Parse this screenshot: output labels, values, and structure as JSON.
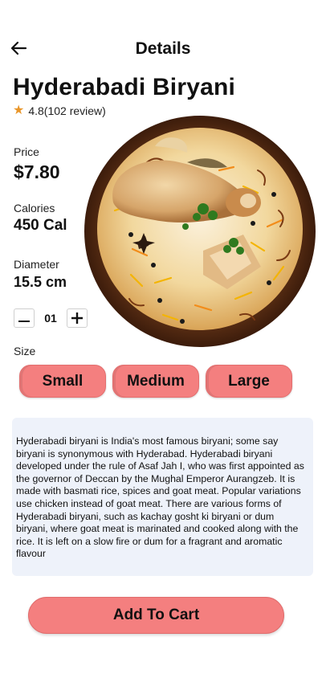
{
  "header": {
    "title": "Details",
    "back_icon": "arrow-left-icon"
  },
  "food": {
    "name": "Hyderabadi Biryani",
    "rating_icon": "star-icon",
    "rating_text": "4.8(102 review)",
    "image_icon": "biryani-bowl-image"
  },
  "stats": {
    "price_label": "Price",
    "price_value": "$7.80",
    "calories_label": "Calories",
    "calories_value": "450 Cal",
    "diameter_label": "Diameter",
    "diameter_value": "15.5 cm"
  },
  "quantity": {
    "value": "01",
    "minus_icon": "minus-icon",
    "plus_icon": "plus-icon"
  },
  "size": {
    "label": "Size",
    "options": [
      "Small",
      "Medium",
      "Large"
    ]
  },
  "description": "Hyderabadi biryani is India's most famous biryani; some say biryani is synonymous with Hyderabad. Hyderabadi biryani developed under the rule of Asaf Jah I, who was first appointed as the governor of Deccan by the Mughal Emperor Aurangzeb. It is made with basmati rice, spices and goat meat. Popular variations use chicken instead of goat meat. There are various forms of Hyderabadi biryani, such as kachay gosht ki biryani or dum biryani, where goat meat is marinated and cooked along with the rice. It is left on a slow fire or dum for a fragrant and aromatic flavour",
  "cart": {
    "label": "Add To Cart"
  },
  "colors": {
    "accent": "#f47f7f",
    "card_bg": "#eef2fa",
    "star": "#e9962a"
  }
}
